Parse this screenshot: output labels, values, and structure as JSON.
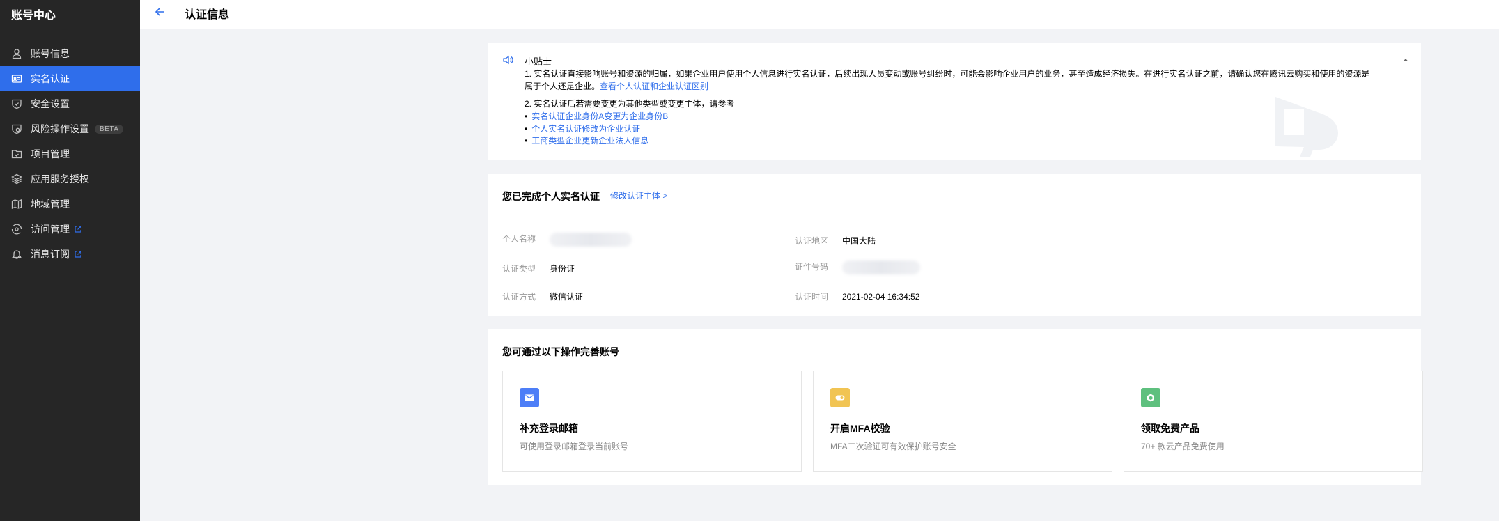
{
  "sidebar": {
    "brand": "账号中心",
    "items": [
      {
        "label": "账号信息",
        "icon": "user-icon"
      },
      {
        "label": "实名认证",
        "icon": "id-card-icon",
        "active": true
      },
      {
        "label": "安全设置",
        "icon": "shield-icon"
      },
      {
        "label": "风险操作设置",
        "icon": "risk-shield-icon",
        "badge": "BETA"
      },
      {
        "label": "项目管理",
        "icon": "folder-icon"
      },
      {
        "label": "应用服务授权",
        "icon": "layers-icon"
      },
      {
        "label": "地域管理",
        "icon": "map-icon"
      },
      {
        "label": "访问管理",
        "icon": "access-icon",
        "external": true
      },
      {
        "label": "消息订阅",
        "icon": "bell-icon",
        "external": true
      }
    ]
  },
  "header": {
    "title": "认证信息"
  },
  "tips": {
    "title": "小贴士",
    "line1": "1. 实名认证直接影响账号和资源的归属，如果企业用户使用个人信息进行实名认证，后续出现人员变动或账号纠纷时，可能会影响企业用户的业务，甚至造成经济损失。在进行实名认证之前，请确认您在腾讯云购买和使用的资源是",
    "line2_text": "属于个人还是企业。",
    "line2_link": "查看个人认证和企业认证区别",
    "line3": "2. 实名认证后若需要变更为其他类型或变更主体，请参考",
    "links": [
      "实名认证企业身份A变更为企业身份B",
      "个人实名认证修改为企业认证",
      "工商类型企业更新企业法人信息"
    ]
  },
  "auth": {
    "title": "您已完成个人实名认证",
    "edit_link": "修改认证主体 >",
    "fields": {
      "name_label": "个人名称",
      "region_label": "认证地区",
      "region_value": "中国大陆",
      "type_label": "认证类型",
      "type_value": "身份证",
      "id_label": "证件号码",
      "method_label": "认证方式",
      "method_value": "微信认证",
      "time_label": "认证时间",
      "time_value": "2021-02-04 16:34:52"
    }
  },
  "ops": {
    "title": "您可通过以下操作完善账号",
    "cards": [
      {
        "title": "补充登录邮箱",
        "desc": "可使用登录邮箱登录当前账号",
        "icon": "mail-icon",
        "color": "#4d7ef7"
      },
      {
        "title": "开启MFA校验",
        "desc": "MFA二次验证可有效保护账号安全",
        "icon": "toggle-icon",
        "color": "#f1c453"
      },
      {
        "title": "领取免费产品",
        "desc": "70+ 款云产品免费使用",
        "icon": "cube-icon",
        "color": "#5ec07e"
      }
    ]
  }
}
